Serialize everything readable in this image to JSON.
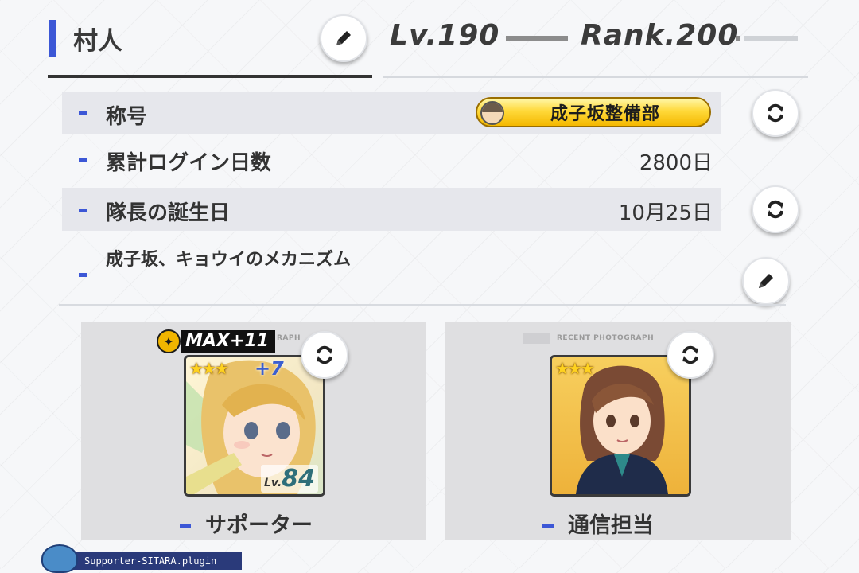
{
  "header": {
    "player_name": "村人",
    "level": "Lv.190",
    "rank": "Rank.200"
  },
  "info_rows": {
    "title": {
      "label": "称号",
      "value": "成子坂整備部"
    },
    "login_days": {
      "label": "累計ログイン日数",
      "value": "2800日"
    },
    "birthday": {
      "label": "隊長の誕生日",
      "value": "10月25日"
    },
    "comment": {
      "text": "成子坂、キョウイのメカニズム"
    }
  },
  "cards": {
    "supporter": {
      "max_badge": "MAX+11",
      "panel_label": "RAPH",
      "stars": "★★★",
      "plus": "+7",
      "level_prefix": "Lv.",
      "level_value": "84",
      "caption": "サポーター"
    },
    "communicator": {
      "panel_label": "RECENT PHOTOGRAPH",
      "stars": "★★★",
      "caption": "通信担当"
    }
  },
  "footer": {
    "plugin_label": "Supporter-SITARA.plugin"
  },
  "colors": {
    "accent": "#3c57d6",
    "badge_gold": "#ffd93a",
    "row_shade": "#e6e7ec"
  }
}
